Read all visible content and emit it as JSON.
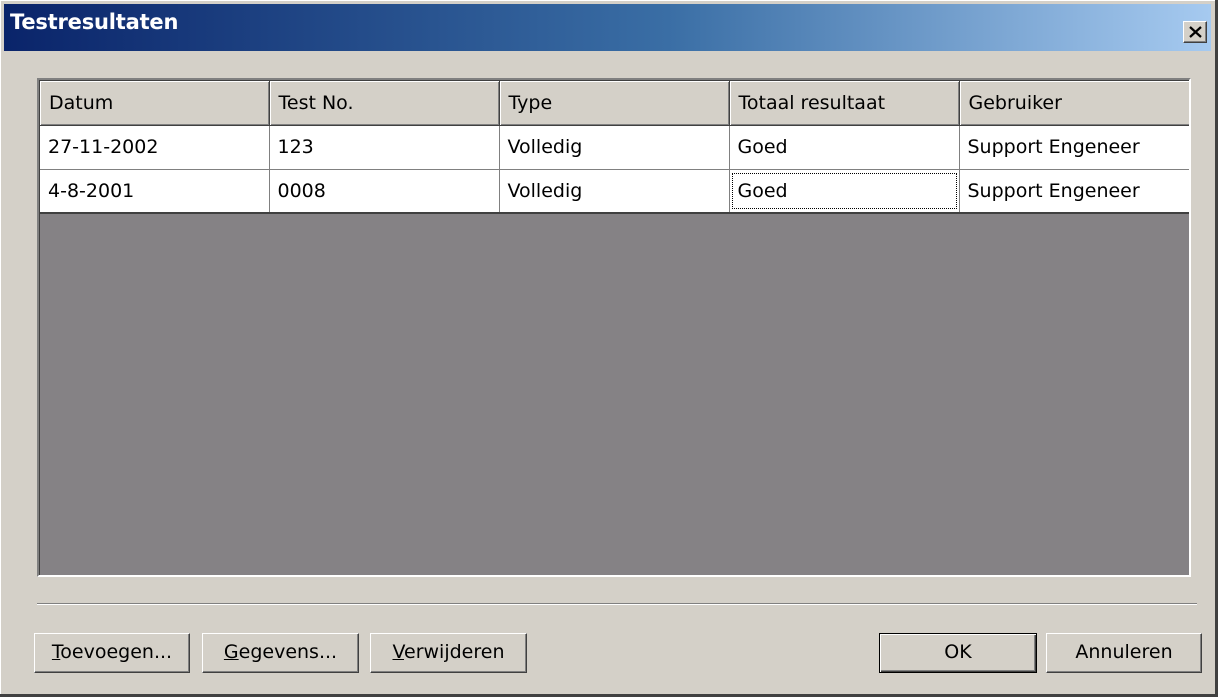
{
  "window": {
    "title": "Testresultaten"
  },
  "colors": {
    "titlebar_start": "#0a246a",
    "titlebar_end": "#a6caf0",
    "face": "#d4d0c8",
    "grid_empty": "#858285"
  },
  "grid": {
    "columns": [
      "Datum",
      "Test No.",
      "Type",
      "Totaal resultaat",
      "Gebruiker"
    ],
    "rows": [
      [
        "27-11-2002",
        "123",
        "Volledig",
        "Goed",
        "Support Engeneer"
      ],
      [
        "4-8-2001",
        "0008",
        "Volledig",
        "Goed",
        "Support Engeneer"
      ]
    ],
    "focused_cell": {
      "row": 1,
      "column": 3
    }
  },
  "buttons": {
    "add": {
      "accel": "T",
      "rest": "oevoegen..."
    },
    "details": {
      "accel": "G",
      "rest": "egevens..."
    },
    "delete": {
      "accel": "V",
      "rest": "erwijderen"
    },
    "ok": "OK",
    "cancel": "Annuleren"
  },
  "icons": {
    "close": "close-icon"
  }
}
